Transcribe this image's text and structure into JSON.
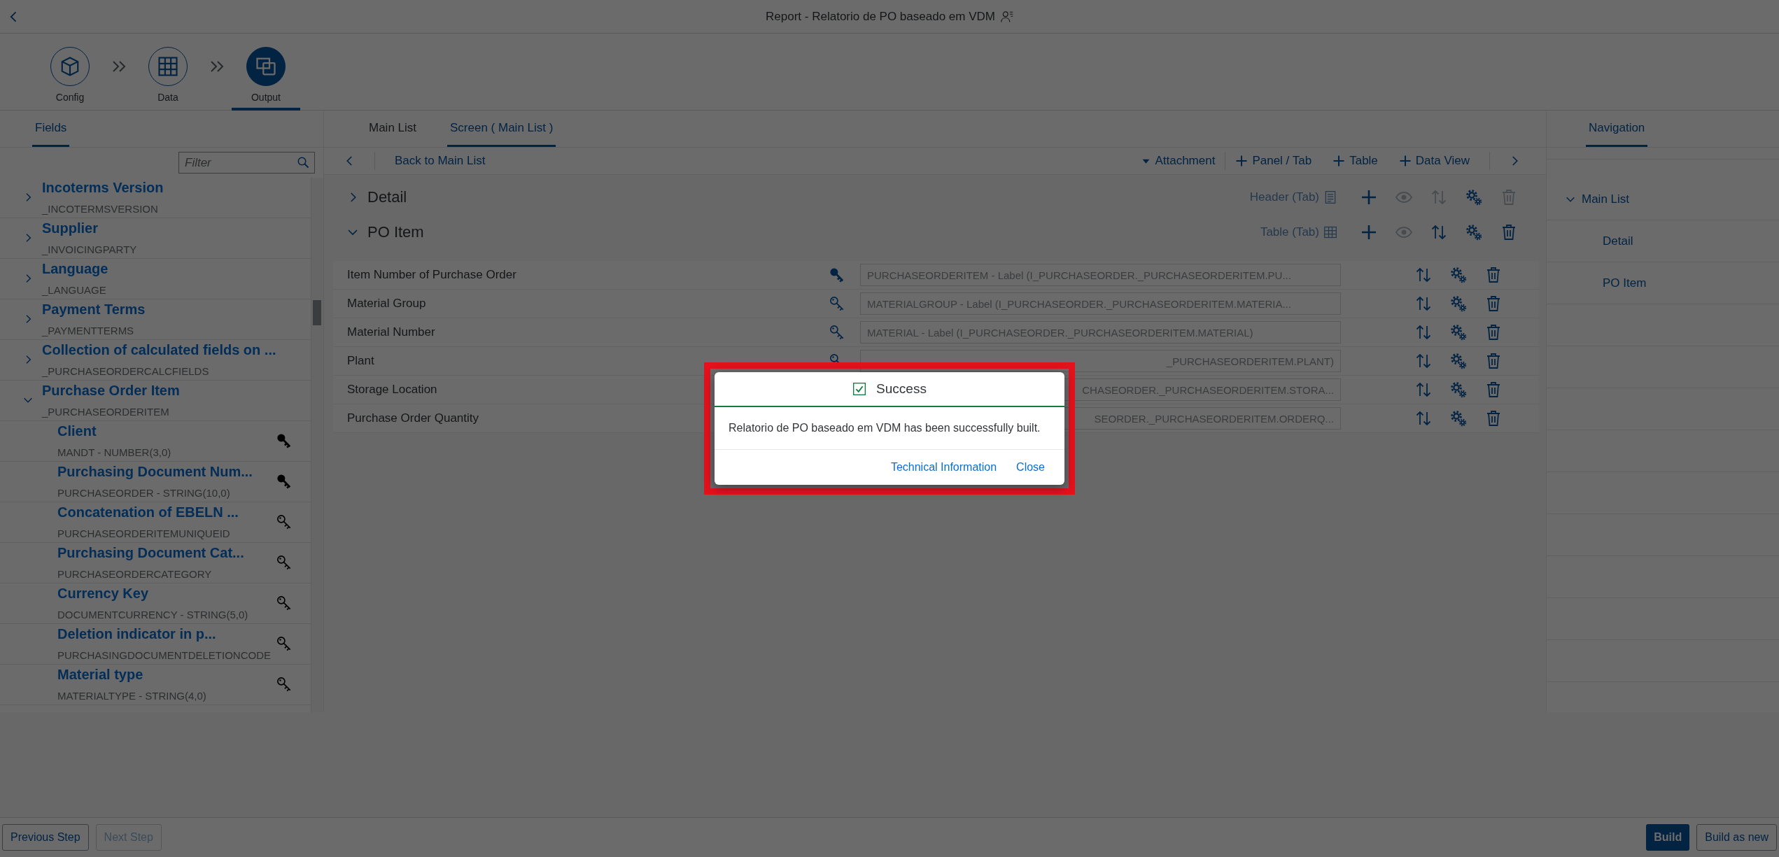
{
  "header": {
    "title": "Report - Relatorio de PO baseado em VDM"
  },
  "steps": [
    {
      "kind": "config",
      "label": "Config",
      "selected": false
    },
    {
      "kind": "data",
      "label": "Data",
      "selected": false
    },
    {
      "kind": "output",
      "label": "Output",
      "selected": true
    }
  ],
  "fields_panel": {
    "tab": {
      "label": "Fields",
      "selected": true
    },
    "filter": {
      "placeholder": "Filter"
    },
    "items": [
      {
        "title": "Incoterms Version",
        "technical": "_INCOTERMSVERSION",
        "expanded": false
      },
      {
        "title": "Supplier",
        "technical": "_INVOICINGPARTY",
        "expanded": false
      },
      {
        "title": "Language",
        "technical": "_LANGUAGE",
        "expanded": false
      },
      {
        "title": "Payment Terms",
        "technical": "_PAYMENTTERMS",
        "expanded": false
      },
      {
        "title": "Collection of calculated fields on ...",
        "technical": "_PURCHASEORDERCALCFIELDS",
        "expanded": false
      },
      {
        "title": "Purchase Order Item",
        "technical": "_PURCHASEORDERITEM",
        "expanded": true,
        "children": [
          {
            "title": "Client",
            "technical": "MANDT - NUMBER(3,0)",
            "kind": "key_field"
          },
          {
            "title": "Purchasing Document Num...",
            "technical": "PURCHASEORDER - STRING(10,0)",
            "kind": "key_field"
          },
          {
            "title": "Concatenation of EBELN ...",
            "technical": "PURCHASEORDERITEMUNIQUEID",
            "kind": "field"
          },
          {
            "title": "Purchasing Document Cat...",
            "technical": "PURCHASEORDERCATEGORY",
            "kind": "field"
          },
          {
            "title": "Currency Key",
            "technical": "DOCUMENTCURRENCY - STRING(5,0)",
            "kind": "field"
          },
          {
            "title": "Deletion indicator in p...",
            "technical": "PURCHASINGDOCUMENTDELETIONCODE",
            "kind": "field"
          },
          {
            "title": "Material type",
            "technical": "MATERIALTYPE - STRING(4,0)",
            "kind": "field"
          }
        ]
      }
    ]
  },
  "screen_panel": {
    "tabs": [
      {
        "label": "Main List",
        "selected": false
      },
      {
        "label": "Screen ( Main List )",
        "selected": true
      }
    ],
    "toolbar": {
      "back": "Back to Main List",
      "actions": [
        {
          "kind": "dropdown",
          "label": "Attachment"
        },
        {
          "kind": "add",
          "label": "Panel / Tab"
        },
        {
          "kind": "add",
          "label": "Table"
        },
        {
          "kind": "add",
          "label": "Data View"
        }
      ]
    },
    "sections": [
      {
        "title": "Detail",
        "expanded": false,
        "kind": "header",
        "type_label": "Header (Tab)",
        "tools": [
          {
            "kind": "add",
            "disabled": false
          },
          {
            "kind": "view",
            "disabled": true
          },
          {
            "kind": "sort",
            "disabled": true
          },
          {
            "kind": "settings",
            "disabled": false
          },
          {
            "kind": "delete",
            "disabled": true
          }
        ]
      },
      {
        "title": "PO Item",
        "expanded": true,
        "kind": "table",
        "type_label": "Table (Tab)",
        "tools": [
          {
            "kind": "add",
            "disabled": false
          },
          {
            "kind": "view",
            "disabled": true
          },
          {
            "kind": "sort",
            "disabled": false
          },
          {
            "kind": "settings",
            "disabled": false
          },
          {
            "kind": "delete",
            "disabled": false
          }
        ]
      }
    ],
    "rows": [
      {
        "label": "Item Number of Purchase Order",
        "kind": "key_field",
        "value": "PURCHASEORDERITEM - Label (I_PURCHASEORDER._PURCHASEORDERITEM.PU...",
        "covered": false
      },
      {
        "label": "Material Group",
        "kind": "field",
        "value": "MATERIALGROUP - Label (I_PURCHASEORDER._PURCHASEORDERITEM.MATERIA...",
        "covered": false
      },
      {
        "label": "Material Number",
        "kind": "field",
        "value": "MATERIAL - Label (I_PURCHASEORDER._PURCHASEORDERITEM.MATERIAL)",
        "covered": false
      },
      {
        "label": "Plant",
        "kind": "field",
        "value": "_PURCHASEORDERITEM.PLANT)",
        "covered": true
      },
      {
        "label": "Storage Location",
        "kind": "field",
        "value": "CHASEORDER._PURCHASEORDERITEM.STORA...",
        "covered": true
      },
      {
        "label": "Purchase Order Quantity",
        "kind": "field",
        "value": "SEORDER._PURCHASEORDERITEM.ORDERQ...",
        "covered": true
      }
    ]
  },
  "navigation": {
    "tab": {
      "label": "Navigation",
      "selected": true
    },
    "items": [
      {
        "label": "Main List",
        "expanded": true,
        "children": [
          {
            "label": "Detail"
          },
          {
            "label": "PO Item"
          }
        ]
      }
    ]
  },
  "footer": {
    "left": [
      {
        "label": "Previous Step",
        "kind": "default",
        "disabled": false
      },
      {
        "label": "Next Step",
        "kind": "default",
        "disabled": true
      }
    ],
    "right": [
      {
        "label": "Build",
        "kind": "emphasized",
        "disabled": false
      },
      {
        "label": "Build as new",
        "kind": "default",
        "disabled": false
      }
    ]
  },
  "dialog": {
    "title": "Success",
    "message": "Relatorio de PO baseado em VDM has been successfully built.",
    "buttons": [
      "Technical Information",
      "Close"
    ]
  }
}
